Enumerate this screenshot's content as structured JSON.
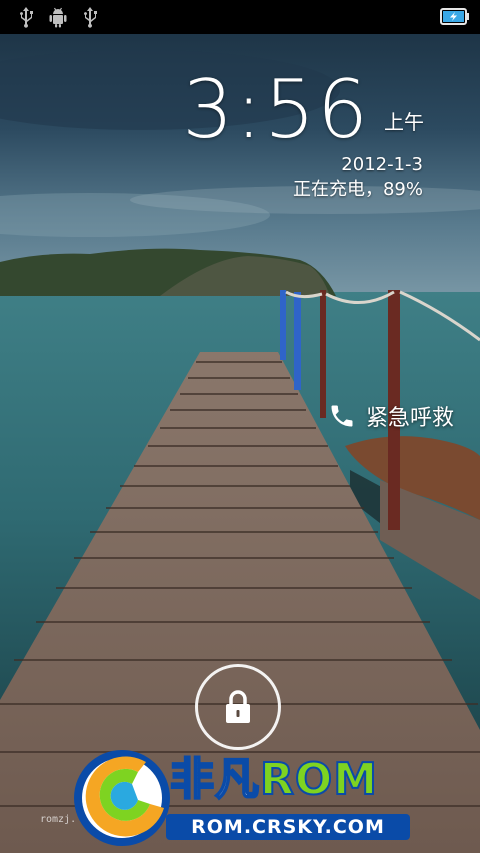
{
  "status_bar": {
    "icons": [
      "usb-icon",
      "android-debug-icon",
      "usb-icon"
    ],
    "battery_icon": "battery-charging-icon"
  },
  "lockscreen": {
    "time": "3:56",
    "ampm": "上午",
    "date": "2012-1-3",
    "charging_status": "正在充电，89%",
    "emergency_label": "紧急呼救",
    "unlock_icon": "lock-icon"
  },
  "watermark": {
    "brand_a": "非凡",
    "brand_b": "ROM",
    "url": "ROM.CRSKY.COM",
    "small_text": "romzj."
  },
  "colors": {
    "status_bar": "#000000",
    "battery_fill": "#3aa8e6",
    "text": "#ffffff"
  }
}
